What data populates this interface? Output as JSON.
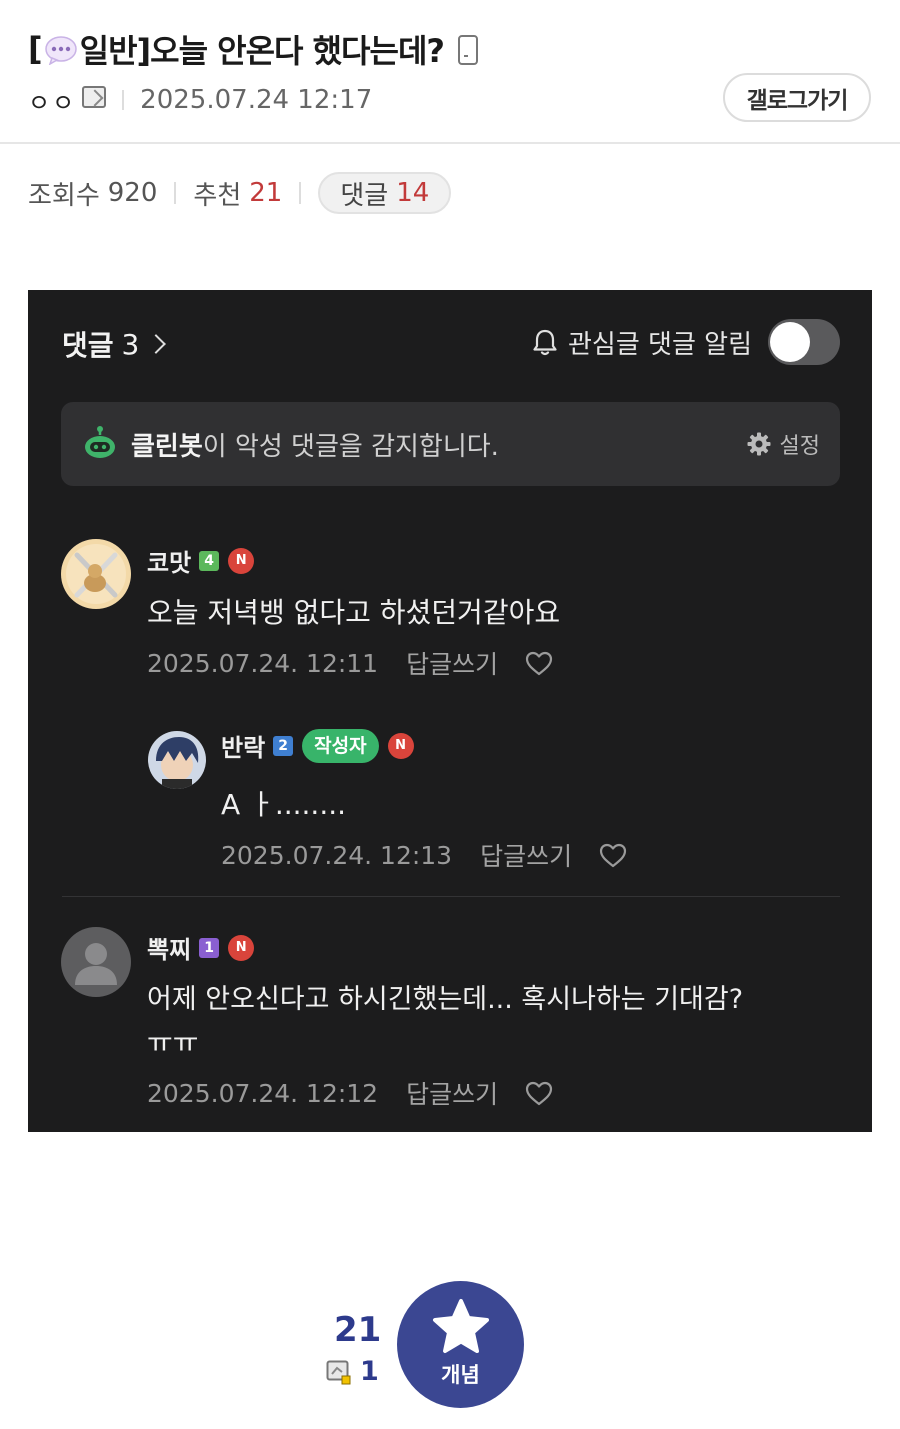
{
  "post": {
    "title_prefix_open": "[",
    "category": "일반]",
    "title": " 오늘 안온다 했다는데?",
    "author": "ㅇㅇ",
    "date": "2025.07.24 12:17",
    "gallog_button": "갤로그가기"
  },
  "stats": {
    "views_label": "조회수",
    "views": "920",
    "recommend_label": "추천",
    "recommend": "21",
    "comments_label": "댓글",
    "comments": "14"
  },
  "screenshot": {
    "header_label": "댓글",
    "header_count": "3",
    "notify_label": "관심글 댓글 알림",
    "cleanbot_name": "클린봇",
    "cleanbot_text": "이 악성 댓글을 감지합니다.",
    "settings_label": "설정",
    "comments": [
      {
        "nickname": "코맛",
        "level": "4",
        "new_badge": "N",
        "text": "오늘 저녁뱅 없다고 하셨던거같아요",
        "date": "2025.07.24. 12:11",
        "reply_label": "답글쓰기"
      },
      {
        "nickname": "반락",
        "level": "2",
        "writer_badge": "작성자",
        "new_badge": "N",
        "text": "A ㅏ........",
        "date": "2025.07.24. 12:13",
        "reply_label": "답글쓰기"
      },
      {
        "nickname": "뽁찌",
        "level": "1",
        "new_badge": "N",
        "text_line1": "어제 안오신다고 하시긴했는데... 혹시나하는 기대감?",
        "text_line2": "ㅠㅠ",
        "date": "2025.07.24. 12:12",
        "reply_label": "답글쓰기"
      }
    ]
  },
  "recommend": {
    "count": "21",
    "fixed_count": "1",
    "button_label": "개념"
  },
  "colors": {
    "accent_red": "#c23a3a",
    "concept_navy": "#3b4792",
    "writer_green": "#38b46a",
    "new_red": "#d9443b",
    "dark_bg": "#1c1c1d"
  }
}
